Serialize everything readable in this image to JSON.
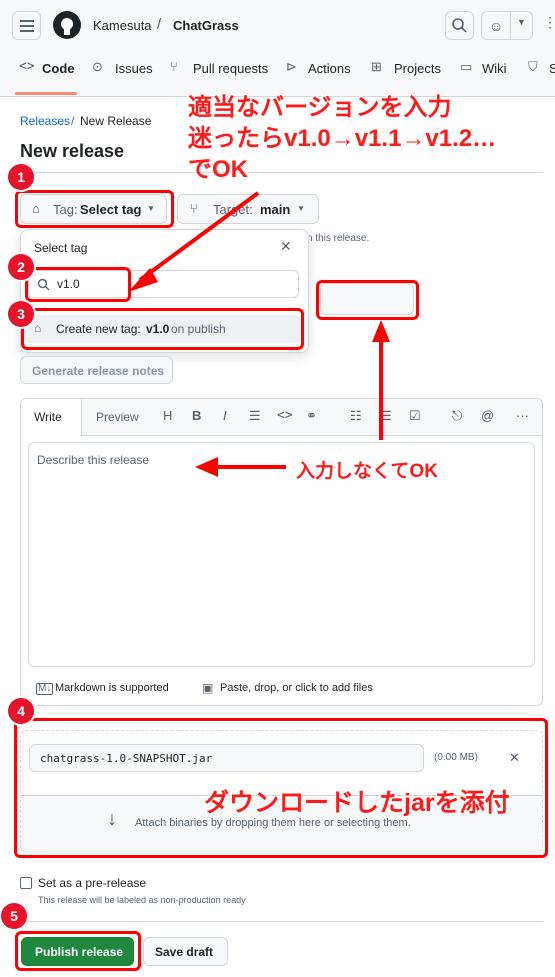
{
  "header": {
    "owner": "Kamesuta",
    "separator": "/",
    "repo": "ChatGrass",
    "tabs": [
      {
        "label": "Code",
        "icon": "code-icon"
      },
      {
        "label": "Issues",
        "icon": "issue-icon"
      },
      {
        "label": "Pull requests",
        "icon": "pull-request-icon"
      },
      {
        "label": "Actions",
        "icon": "actions-icon"
      },
      {
        "label": "Projects",
        "icon": "projects-icon"
      },
      {
        "label": "Wiki",
        "icon": "wiki-icon"
      },
      {
        "label": "S",
        "icon": "security-icon"
      }
    ]
  },
  "breadcrumb": {
    "releases": "Releases",
    "sep": "/",
    "current": "New Release"
  },
  "page_title": "New release",
  "tag_button": {
    "prefix": "Tag:",
    "value": "Select tag"
  },
  "target_button": {
    "prefix": "Target:",
    "value": "main"
  },
  "tag_hint_tail": "n this release.",
  "select_tag_popup": {
    "title": "Select tag",
    "search_value": "v1.0",
    "create_prefix": "Create new tag:",
    "create_tag": "v1.0",
    "create_suffix": "on publish"
  },
  "generate_notes": "Generate release notes",
  "editor": {
    "tab_write": "Write",
    "tab_preview": "Preview",
    "placeholder": "Describe this release",
    "markdown_note": "Markdown is supported",
    "attach_note": "Paste, drop, or click to add files"
  },
  "attachment": {
    "filename": "chatgrass-1.0-SNAPSHOT.jar",
    "size": "(0.00 MB)",
    "dropzone": "Attach binaries by dropping them here or selecting them."
  },
  "prerelease": {
    "label": "Set as a pre-release",
    "hint": "This release will be labeled as non-production ready"
  },
  "actions": {
    "publish": "Publish release",
    "draft": "Save draft"
  },
  "annotations": {
    "version_line1": "適当なバージョンを入力",
    "version_line2": "迷ったらv1.0→v1.1→v1.2…",
    "version_line3": "でOK",
    "no_input": "入力しなくてOK",
    "attach_jar": "ダウンロードしたjarを添付",
    "badges": [
      "1",
      "2",
      "3",
      "4",
      "5"
    ]
  },
  "colors": {
    "annotation_red": "#ff0000",
    "publish_green": "#1f883d"
  }
}
